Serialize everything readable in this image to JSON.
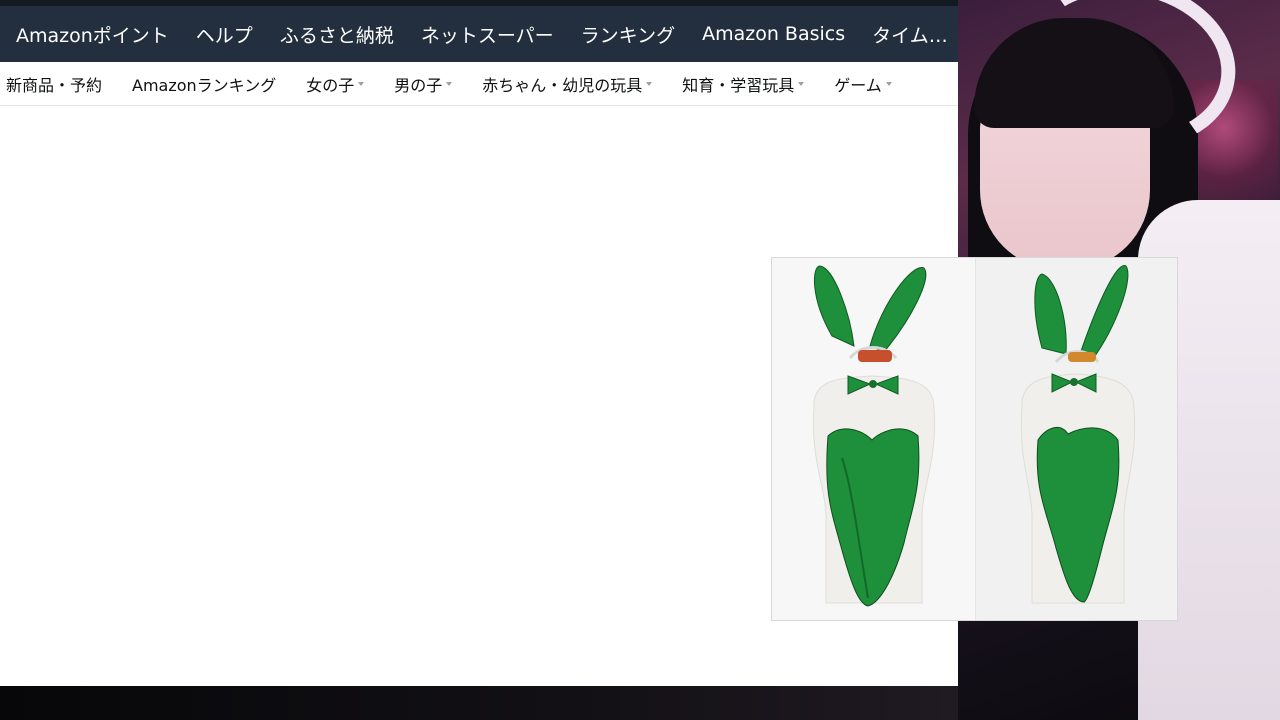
{
  "top_nav": {
    "items": [
      "Amazonポイント",
      "ヘルプ",
      "ふるさと納税",
      "ネットスーパー",
      "ランキング",
      "Amazon Basics",
      "タイム…"
    ]
  },
  "sub_nav": {
    "items": [
      {
        "label": "新商品・予約",
        "has_caret": false
      },
      {
        "label": "Amazonランキング",
        "has_caret": false
      },
      {
        "label": "女の子",
        "has_caret": true
      },
      {
        "label": "男の子",
        "has_caret": true
      },
      {
        "label": "赤ちゃん・幼児の玩具",
        "has_caret": true
      },
      {
        "label": "知育・学習玩具",
        "has_caret": true
      },
      {
        "label": "ゲーム",
        "has_caret": true
      }
    ]
  },
  "product_image": {
    "description_icon": "bunny-costume-image",
    "accent_color": "#1e8f3a"
  },
  "colors": {
    "nav_bg": "#232f3e",
    "nav_text": "#ffffff",
    "costume_green": "#1e8f3a"
  }
}
